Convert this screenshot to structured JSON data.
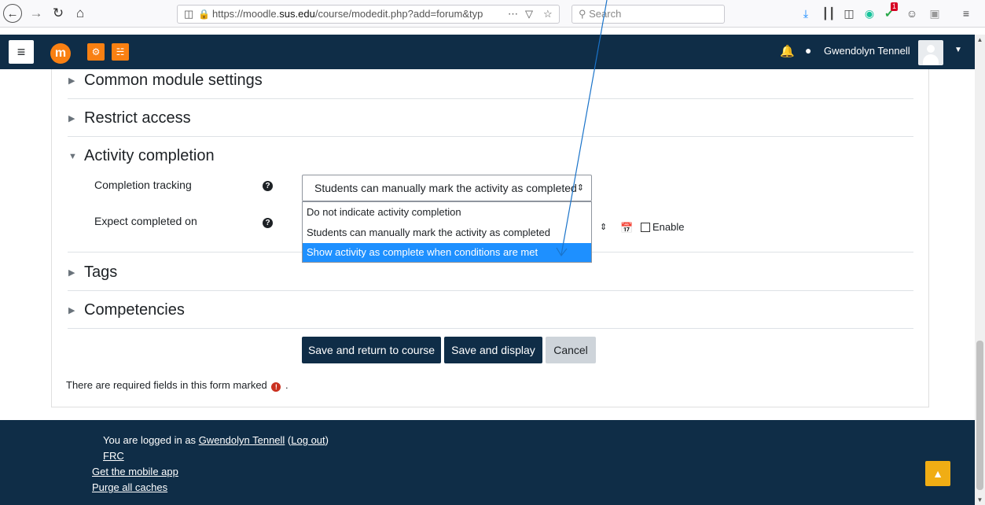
{
  "browser": {
    "url_prefix": "https://moodle.",
    "url_domain": "sus.edu",
    "url_suffix": "/course/modedit.php?add=forum&typ",
    "search_placeholder": "Search",
    "more_label": "⋯",
    "notification_count": "1"
  },
  "navbar": {
    "menu_icon": "≡",
    "logo_letter": "m",
    "user_name": "Gwendolyn Tennell"
  },
  "sections": {
    "common": "Common module settings",
    "restrict": "Restrict access",
    "completion": "Activity completion",
    "tags": "Tags",
    "competencies": "Competencies"
  },
  "completion": {
    "tracking_label": "Completion tracking",
    "expected_label": "Expect completed on",
    "selected_value": "Students can manually mark the activity as completed",
    "options": [
      "Do not indicate activity completion",
      "Students can manually mark the activity as completed",
      "Show activity as complete when conditions are met"
    ],
    "highlighted_option_index": 2,
    "enable_label": "Enable"
  },
  "buttons": {
    "save_return": "Save and return to course",
    "save_display": "Save and display",
    "cancel": "Cancel"
  },
  "required_note": {
    "text_before": "There are required fields in this form marked",
    "text_after": "."
  },
  "footer": {
    "logged_in_prefix": "You are logged in as",
    "user_link": "Gwendolyn Tennell",
    "logout_link": "Log out",
    "course_short": "FRC",
    "mobile_app": "Get the mobile app",
    "purge": "Purge all caches"
  },
  "colors": {
    "navbar": "#0f2d47",
    "brand_orange": "#f98012",
    "selected_option": "#1e90ff",
    "back_to_top": "#f0ad14"
  }
}
